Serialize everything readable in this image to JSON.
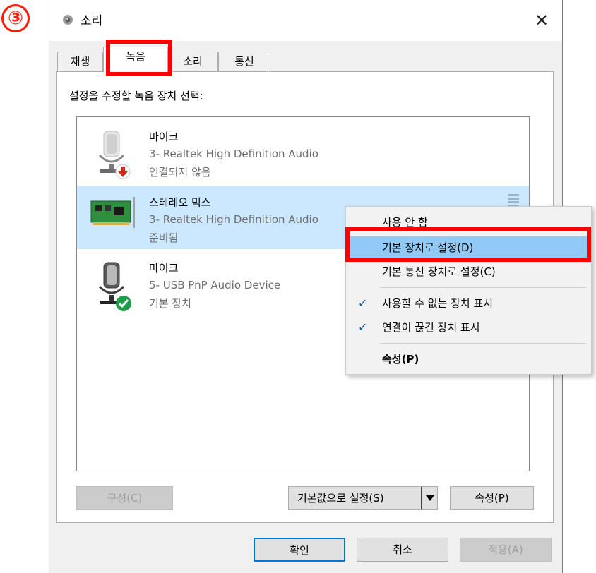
{
  "step_marker": "③",
  "window": {
    "title": "소리",
    "close_glyph": "✕"
  },
  "tabs": [
    {
      "label": "재생"
    },
    {
      "label": "녹음"
    },
    {
      "label": "소리"
    },
    {
      "label": "통신"
    }
  ],
  "instruction": "설정을 수정할 녹음 장치 선택:",
  "devices": [
    {
      "name": "마이크",
      "description": "3- Realtek High Definition Audio",
      "status": "연결되지 않음",
      "icon": "microphone-icon",
      "badge": "disconnected-arrow-icon"
    },
    {
      "name": "스테레오 믹스",
      "description": "3- Realtek High Definition Audio",
      "status": "준비됨",
      "icon": "sound-card-icon",
      "selected": true
    },
    {
      "name": "마이크",
      "description": "5- USB PnP Audio Device",
      "status": "기본 장치",
      "icon": "microphone-icon",
      "badge": "default-check-icon"
    }
  ],
  "buttons": {
    "configure": "구성(C)",
    "set_default": "기본값으로 설정(S)",
    "properties": "속성(P)",
    "ok": "확인",
    "cancel": "취소",
    "apply": "적용(A)"
  },
  "context_menu": {
    "items": [
      {
        "label": "사용 안 함",
        "checked": false
      },
      {
        "label": "기본 장치로 설정(D)",
        "checked": false,
        "highlighted": true
      },
      {
        "label": "기본 통신 장치로 설정(C)",
        "checked": false
      },
      {
        "label": "사용할 수 없는 장치 표시",
        "checked": true
      },
      {
        "label": "연결이 끊긴 장치 표시",
        "checked": true
      },
      {
        "label": "속성(P)",
        "checked": false,
        "bold": true
      }
    ],
    "check_glyph": "✓"
  },
  "colors": {
    "highlight_box": "#ff0000",
    "selection": "#cce8ff",
    "menu_hover": "#91c9f7"
  }
}
